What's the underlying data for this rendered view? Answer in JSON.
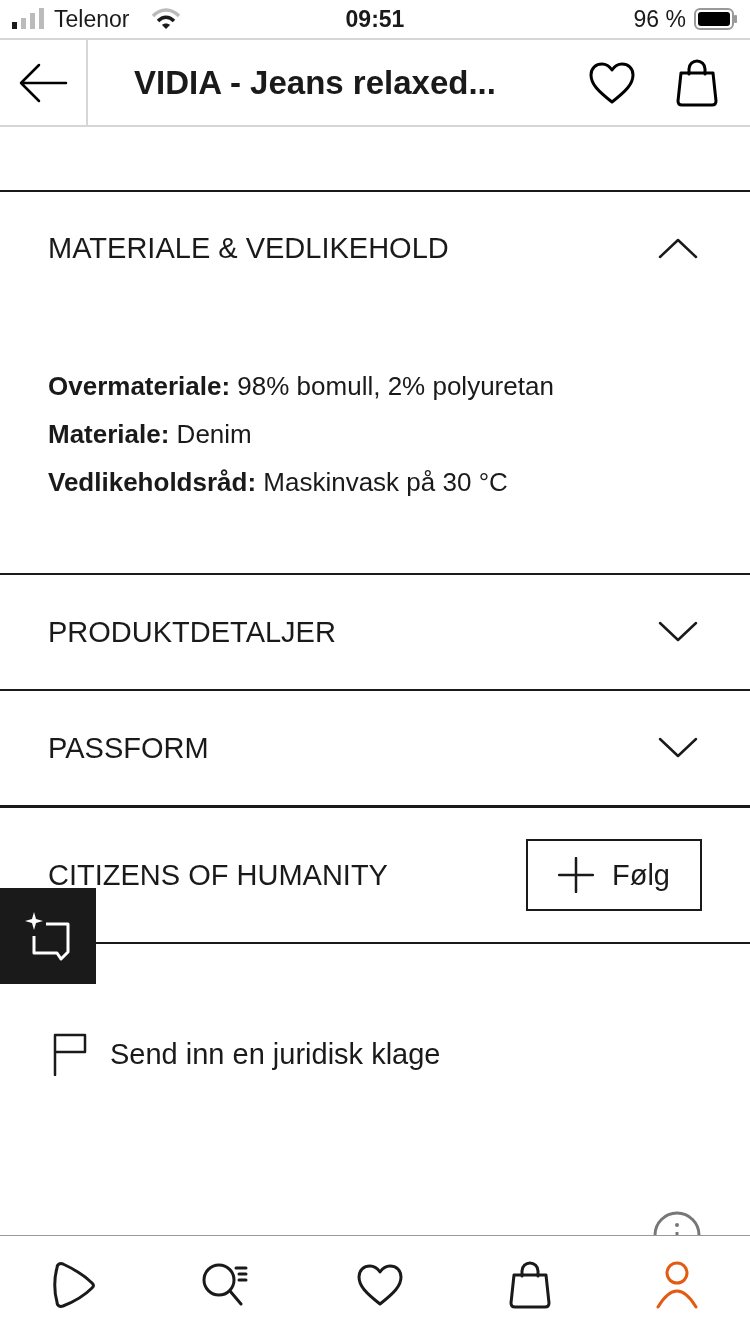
{
  "status_bar": {
    "carrier": "Telenor",
    "time": "09:51",
    "battery": "96 %"
  },
  "nav": {
    "title": "VIDIA - Jeans relaxed..."
  },
  "sections": [
    {
      "title": "MATERIALE & VEDLIKEHOLD",
      "expanded": true,
      "details": [
        "**Overmateriale:** 98% bomull, 2% polyuretan",
        "**Materiale:** Denim",
        "**Vedlikeholdsråd:** Maskinvask på 30 °C"
      ]
    },
    {
      "title": "PRODUKTDETALJER",
      "expanded": false
    },
    {
      "title": "PASSFORM",
      "expanded": false
    }
  ],
  "brand": {
    "name": "CITIZENS OF HUMANITY",
    "follow_label": "Følg"
  },
  "complaint_link": "Send inn en juridisk klage",
  "tab_bar": [
    {
      "selected": false
    },
    {
      "selected": false
    },
    {
      "selected": false
    },
    {
      "selected": false
    },
    {
      "selected": true
    }
  ]
}
